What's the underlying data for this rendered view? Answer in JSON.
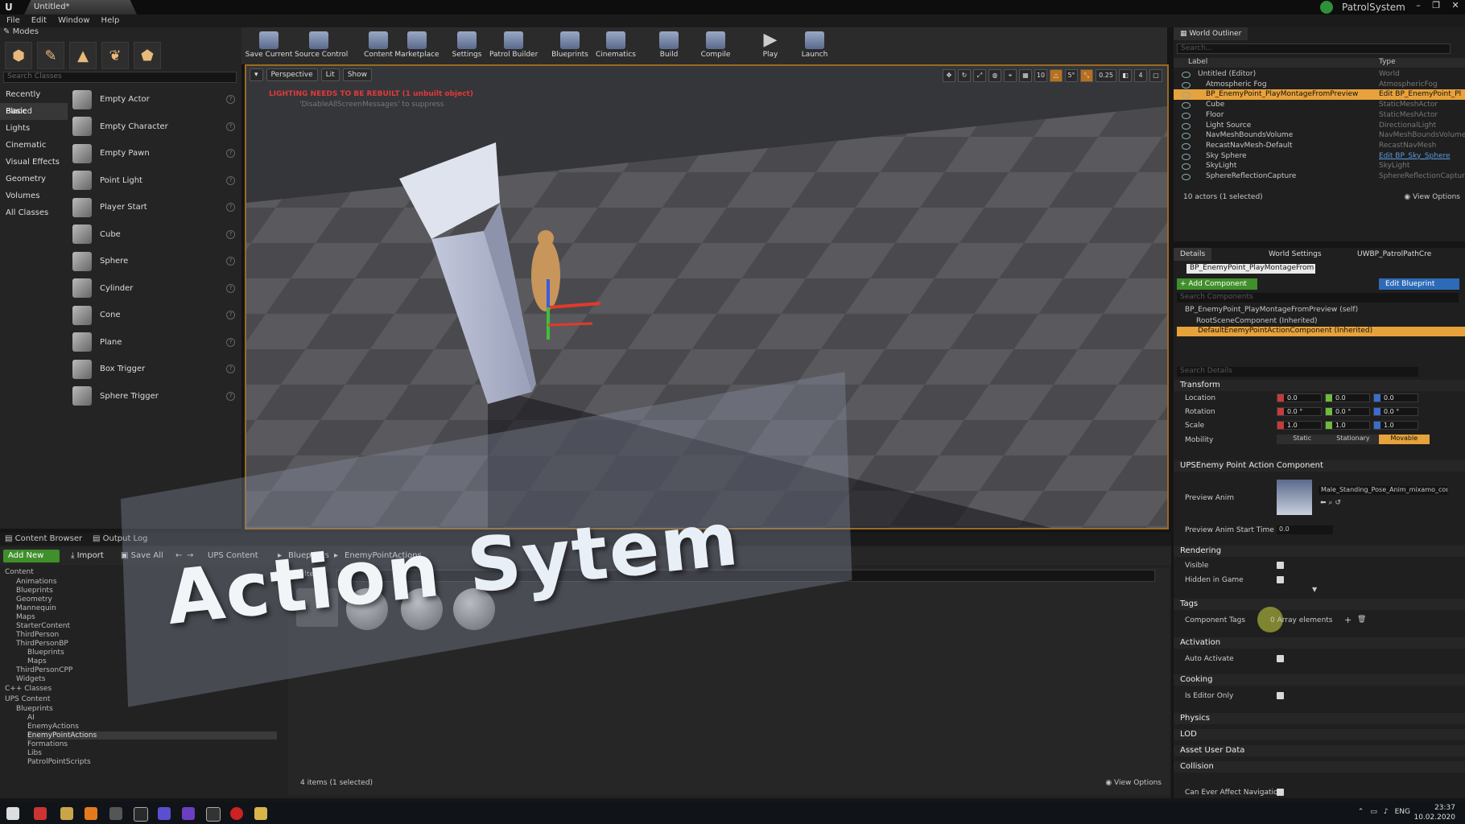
{
  "window": {
    "doc_tab": "Untitled*",
    "project_name": "PatrolSystem",
    "controls": [
      "–",
      "❐",
      "✕"
    ]
  },
  "menu": [
    "File",
    "Edit",
    "Window",
    "Help"
  ],
  "modes": {
    "tab_label": "Modes",
    "search_placeholder": "Search Classes",
    "categories": [
      "Recently Placed",
      "Basic",
      "Lights",
      "Cinematic",
      "Visual Effects",
      "Geometry",
      "Volumes",
      "All Classes"
    ],
    "active_category": "Basic",
    "items": [
      "Empty Actor",
      "Empty Character",
      "Empty Pawn",
      "Point Light",
      "Player Start",
      "Cube",
      "Sphere",
      "Cylinder",
      "Cone",
      "Plane",
      "Box Trigger",
      "Sphere Trigger"
    ]
  },
  "toolbar": {
    "buttons": [
      "Save Current",
      "Source Control",
      "Content",
      "Marketplace",
      "Settings",
      "Patrol Builder",
      "Blueprints",
      "Cinematics",
      "Build",
      "Compile",
      "Play",
      "Launch"
    ]
  },
  "viewport": {
    "perspective_label": "Perspective",
    "lit_label": "Lit",
    "show_label": "Show",
    "warning": "LIGHTING NEEDS TO BE REBUILT (1 unbuilt object)",
    "warning_sub": "'DisableAllScreenMessages' to suppress",
    "snap_grid": "10",
    "snap_rot": "5°",
    "snap_scale": "0.25",
    "cam_speed": "4"
  },
  "outliner": {
    "tab_label": "World Outliner",
    "search_placeholder": "Search...",
    "col_label": "Label",
    "col_type": "Type",
    "rows": [
      {
        "label": "Untitled (Editor)",
        "type": "World"
      },
      {
        "label": "Atmospheric Fog",
        "type": "AtmosphericFog"
      },
      {
        "label": "BP_EnemyPoint_PlayMontageFromPreview",
        "type": "Edit BP_EnemyPoint_Pl"
      },
      {
        "label": "Cube",
        "type": "StaticMeshActor"
      },
      {
        "label": "Floor",
        "type": "StaticMeshActor"
      },
      {
        "label": "Light Source",
        "type": "DirectionalLight"
      },
      {
        "label": "NavMeshBoundsVolume",
        "type": "NavMeshBoundsVolume"
      },
      {
        "label": "RecastNavMesh-Default",
        "type": "RecastNavMesh"
      },
      {
        "label": "Sky Sphere",
        "type": "Edit BP_Sky_Sphere"
      },
      {
        "label": "SkyLight",
        "type": "SkyLight"
      },
      {
        "label": "SphereReflectionCapture",
        "type": "SphereReflectionCapture"
      }
    ],
    "count": "10 actors (1 selected)",
    "view_options": "View Options"
  },
  "details": {
    "tabs": [
      "Details",
      "World Settings",
      "UWBP_PatrolPathCre"
    ],
    "actor_name": "BP_EnemyPoint_PlayMontageFrom",
    "add_component": "+ Add Component",
    "edit_blueprint": "Edit Blueprint",
    "search_components": "Search Components",
    "self_row": "BP_EnemyPoint_PlayMontageFromPreview (self)",
    "root_row": "RootSceneComponent (Inherited)",
    "selected_component": "DefaultEnemyPointActionComponent (Inherited)",
    "search_details": "Search Details",
    "sections": {
      "transform": "Transform",
      "ups": "UPSEnemy Point Action Component",
      "rendering": "Rendering",
      "tags": "Tags",
      "activation": "Activation",
      "cooking": "Cooking",
      "physics": "Physics",
      "lod": "LOD",
      "asset_user_data": "Asset User Data",
      "collision": "Collision"
    },
    "location_label": "Location",
    "rotation_label": "Rotation",
    "scale_label": "Scale",
    "mobility_label": "Mobility",
    "location": [
      "0.0",
      "0.0",
      "0.0"
    ],
    "rotation": [
      "0.0 °",
      "0.0 °",
      "0.0 °"
    ],
    "scale": [
      "1.0",
      "1.0",
      "1.0"
    ],
    "mobility_opts": [
      "Static",
      "Stationary",
      "Movable"
    ],
    "mobility_active": "Movable",
    "preview_anim_label": "Preview Anim",
    "preview_anim_value": "Male_Standing_Pose_Anim_mixamo_com_",
    "preview_start_label": "Preview Anim Start Time",
    "preview_start_value": "0.0",
    "visible_label": "Visible",
    "hidden_label": "Hidden in Game",
    "component_tags_label": "Component Tags",
    "array_elements": "0 Array elements",
    "auto_activate_label": "Auto Activate",
    "editor_only_label": "Is Editor Only",
    "can_affect_nav_label": "Can Ever Affect Navigation"
  },
  "content_browser": {
    "tabs": [
      "Content Browser",
      "Output Log"
    ],
    "add_new": "Add New",
    "import": "Import",
    "save_all": "Save All",
    "breadcrumb": [
      "UPS Content",
      "Blueprints",
      "EnemyPointActions"
    ],
    "filters": "Filters",
    "tree": [
      {
        "label": "Content",
        "depth": 0
      },
      {
        "label": "Animations",
        "depth": 1
      },
      {
        "label": "Blueprints",
        "depth": 1
      },
      {
        "label": "Geometry",
        "depth": 1
      },
      {
        "label": "Mannequin",
        "depth": 1
      },
      {
        "label": "Maps",
        "depth": 1
      },
      {
        "label": "StarterContent",
        "depth": 1
      },
      {
        "label": "ThirdPerson",
        "depth": 1
      },
      {
        "label": "ThirdPersonBP",
        "depth": 1
      },
      {
        "label": "Blueprints",
        "depth": 2
      },
      {
        "label": "Maps",
        "depth": 2
      },
      {
        "label": "ThirdPersonCPP",
        "depth": 1
      },
      {
        "label": "Widgets",
        "depth": 1
      },
      {
        "label": "C++ Classes",
        "depth": 0
      },
      {
        "label": "UPS Content",
        "depth": 0
      },
      {
        "label": "Blueprints",
        "depth": 1
      },
      {
        "label": "AI",
        "depth": 2
      },
      {
        "label": "EnemyActions",
        "depth": 2
      },
      {
        "label": "EnemyPointActions",
        "depth": 2
      },
      {
        "label": "Formations",
        "depth": 2
      },
      {
        "label": "Libs",
        "depth": 2
      },
      {
        "label": "PatrolPointScripts",
        "depth": 2
      }
    ],
    "selected_folder": "EnemyPointActions",
    "item_count": "4 items (1 selected)",
    "view_options": "View Options"
  },
  "overlay": {
    "title_part1": "Action",
    "title_part2": "Sytem"
  },
  "taskbar": {
    "tray_lang": "ENG",
    "time": "23:37",
    "date": "10.02.2020"
  },
  "colors": {
    "selection": "#e7a23b",
    "viewport_border": "#9a6b1e",
    "add_new_green": "#3f8f2a",
    "edit_blueprint_blue": "#2d6bb8"
  }
}
